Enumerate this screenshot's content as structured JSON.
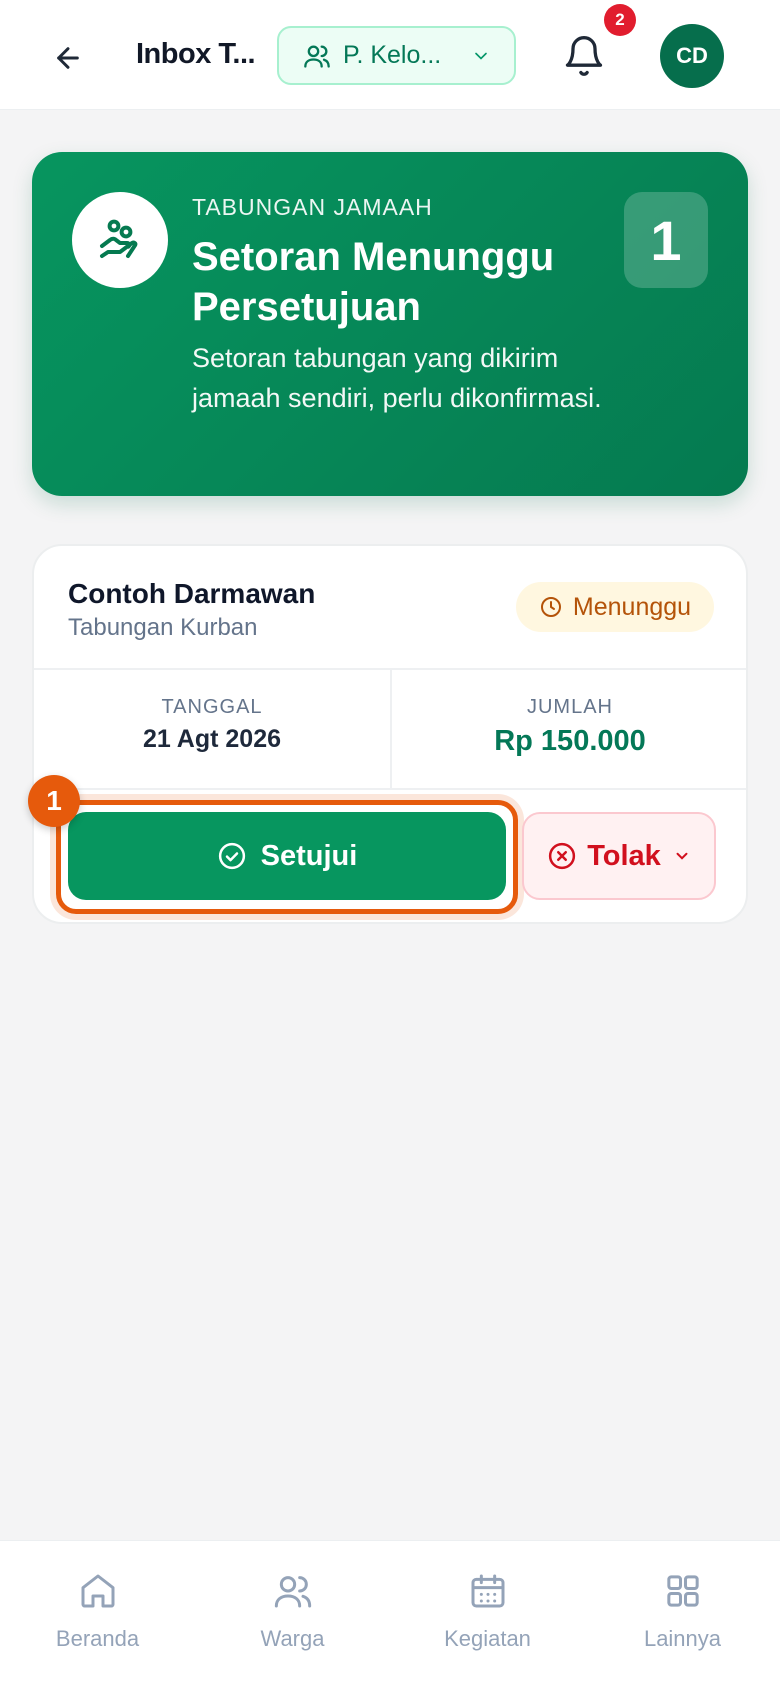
{
  "header": {
    "title": "Inbox T...",
    "scope_label": "P. Kelo...",
    "notification_count": "2",
    "avatar_initials": "CD"
  },
  "hero": {
    "eyebrow": "TABUNGAN JAMAAH",
    "title": "Setoran Menunggu Persetujuan",
    "description": "Setoran tabungan yang dikirim jamaah sendiri, perlu dikonfirmasi.",
    "count": "1"
  },
  "deposit": {
    "name": "Contoh Darmawan",
    "type": "Tabungan Kurban",
    "status": "Menunggu",
    "date_label": "TANGGAL",
    "date_value": "21 Agt 2026",
    "amount_label": "JUMLAH",
    "amount_value": "Rp 150.000",
    "approve_label": "Setujui",
    "reject_label": "Tolak"
  },
  "step_marker": "1",
  "nav": {
    "items": [
      {
        "label": "Beranda",
        "icon": "home-icon"
      },
      {
        "label": "Warga",
        "icon": "users-icon"
      },
      {
        "label": "Kegiatan",
        "icon": "calendar-icon"
      },
      {
        "label": "Lainnya",
        "icon": "grid-icon"
      }
    ]
  },
  "colors": {
    "primary": "#07965f",
    "danger": "#d1101e",
    "warning": "#b45309",
    "highlight": "#e65a0c"
  }
}
